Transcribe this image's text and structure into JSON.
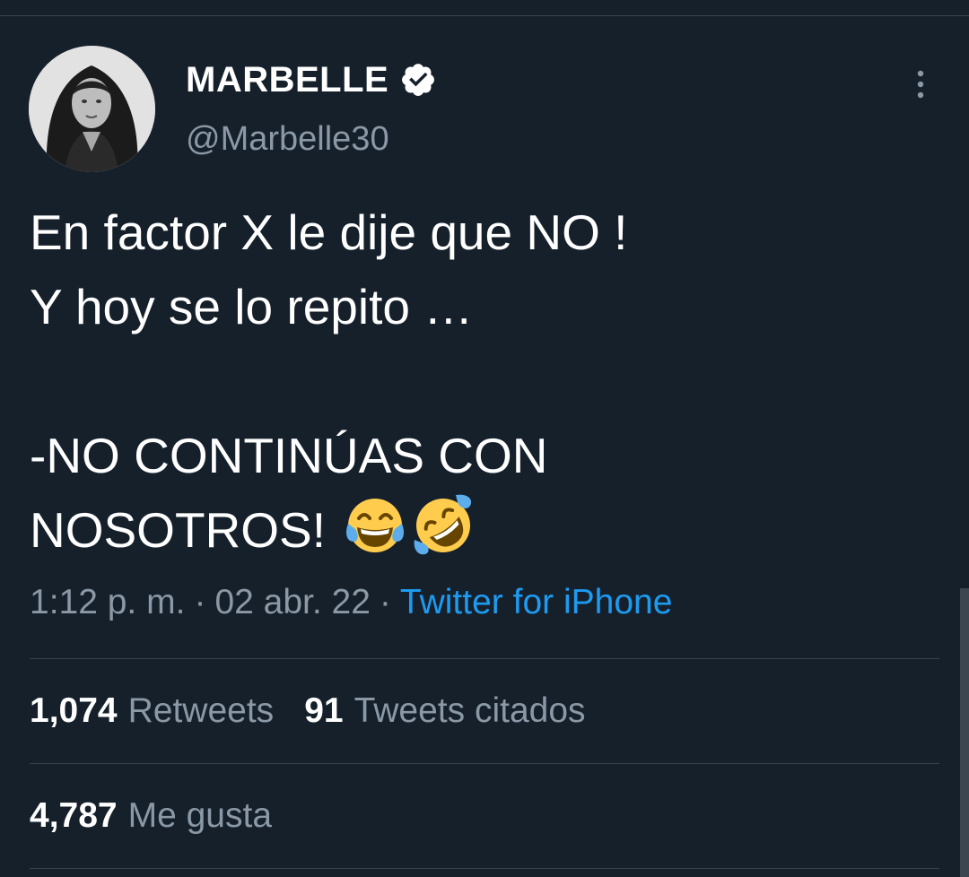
{
  "author": {
    "display_name": "MARBELLE",
    "handle": "@Marbelle30",
    "verified": true
  },
  "tweet": {
    "text": "En factor X le dije que NO !\nY hoy se lo repito …\n\n-NO CONTINÚAS CON\nNOSOTROS! ",
    "emojis": [
      "face-with-tears-of-joy-icon",
      "rolling-on-floor-laughing-icon"
    ]
  },
  "meta": {
    "time": "1:12 p. m.",
    "separator": "·",
    "date": "02 abr. 22",
    "source": "Twitter for iPhone"
  },
  "stats": {
    "retweets_count": "1,074",
    "retweets_label": "Retweets",
    "quotes_count": "91",
    "quotes_label": "Tweets citados",
    "likes_count": "4,787",
    "likes_label": "Me gusta"
  },
  "colors": {
    "background": "#15202b",
    "text_primary": "#ffffff",
    "text_secondary": "#8b98a5",
    "link": "#1d9bf0",
    "divider": "#38444d"
  }
}
